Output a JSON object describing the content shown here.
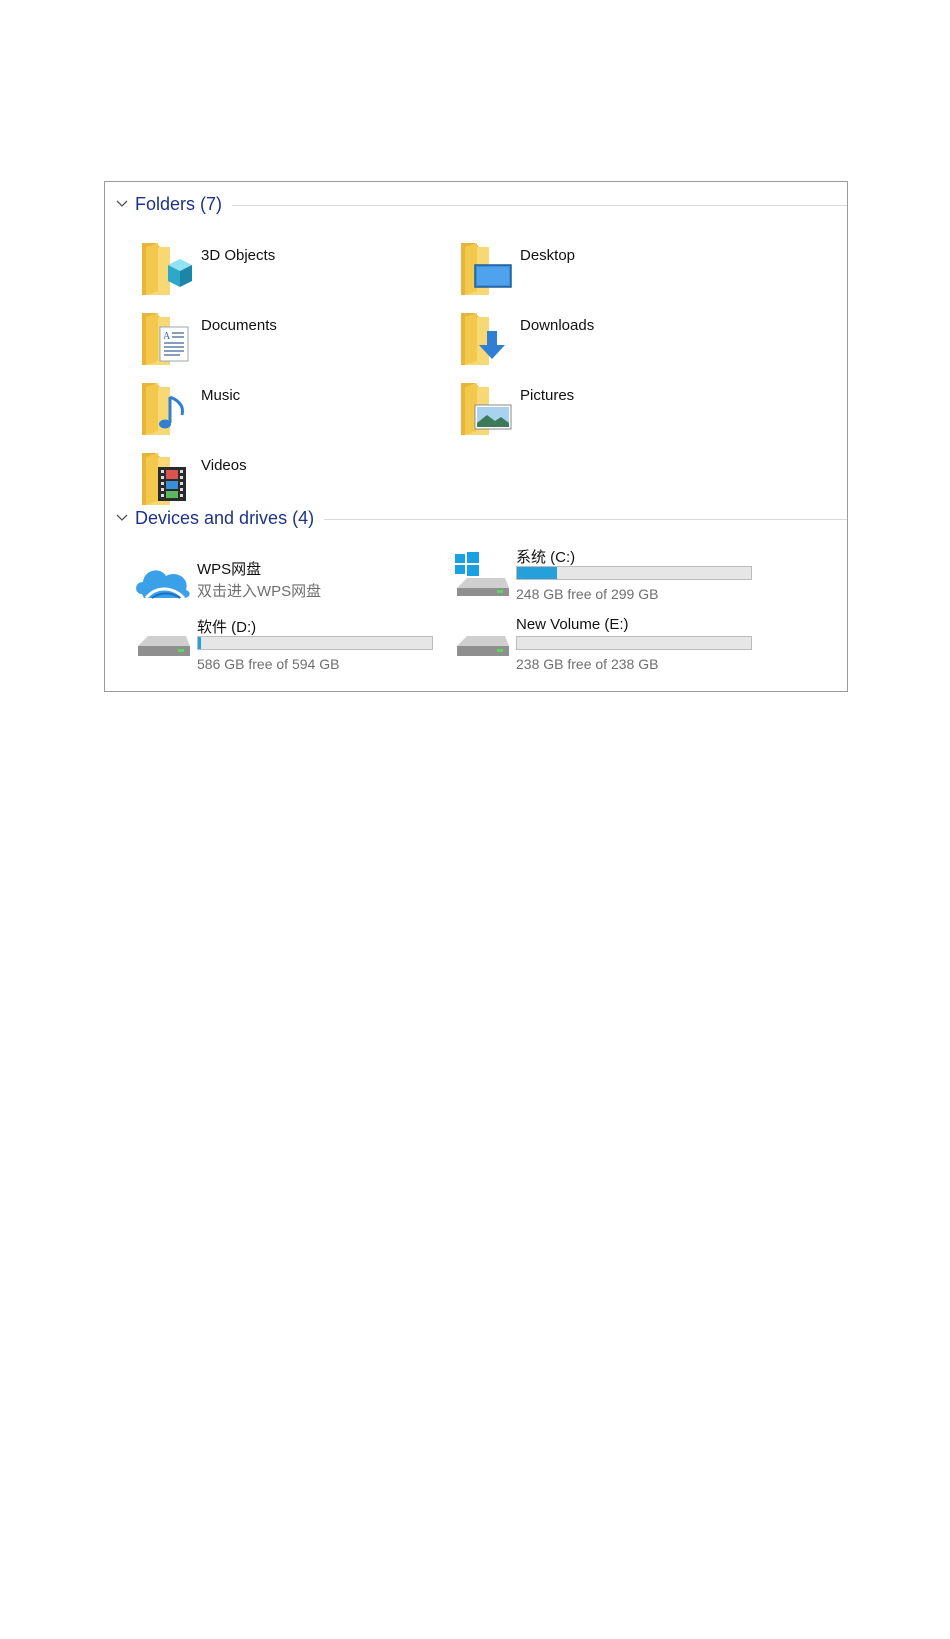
{
  "folders_group": {
    "title": "Folders (7)"
  },
  "folders": [
    {
      "label": "3D Objects",
      "icon": "3d-objects-folder-icon"
    },
    {
      "label": "Desktop",
      "icon": "desktop-folder-icon"
    },
    {
      "label": "Documents",
      "icon": "documents-folder-icon"
    },
    {
      "label": "Downloads",
      "icon": "downloads-folder-icon"
    },
    {
      "label": "Music",
      "icon": "music-folder-icon"
    },
    {
      "label": "Pictures",
      "icon": "pictures-folder-icon"
    },
    {
      "label": "Videos",
      "icon": "videos-folder-icon"
    }
  ],
  "devices_group": {
    "title": "Devices and drives (4)"
  },
  "devices": {
    "wps": {
      "name": "WPS网盘",
      "subtitle": "双击进入WPS网盘",
      "icon": "wps-cloud-icon"
    },
    "c": {
      "name": "系统 (C:)",
      "free": "248 GB free of 299 GB",
      "used_fraction": 0.17,
      "icon": "windows-drive-icon"
    },
    "d": {
      "name": "软件 (D:)",
      "free": "586 GB free of 594 GB",
      "used_fraction": 0.013,
      "icon": "hard-drive-icon"
    },
    "e": {
      "name": "New Volume (E:)",
      "free": "238 GB free of 238 GB",
      "used_fraction": 0.0,
      "icon": "hard-drive-icon"
    }
  },
  "colors": {
    "header_text": "#1e3287",
    "bar_fill": "#26a0da",
    "folder_yellow": "#f3c94d"
  }
}
